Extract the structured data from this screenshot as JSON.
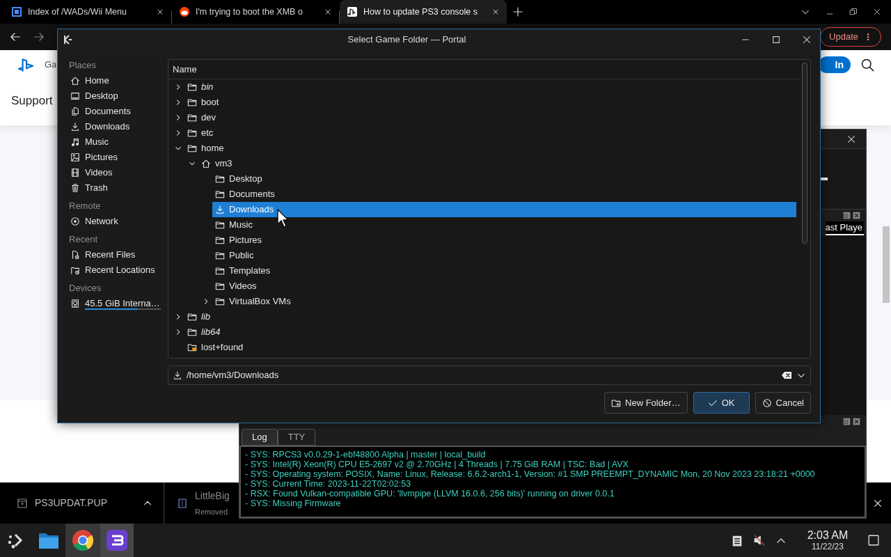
{
  "browser": {
    "tabs": [
      {
        "title": "Index of /WADs/Wii Menu",
        "selected": false
      },
      {
        "title": "I'm trying to boot the XMB o",
        "selected": false
      },
      {
        "title": "How to update PS3 console s",
        "selected": true
      }
    ],
    "update_button": "Update"
  },
  "web_page": {
    "nav_label": "Ga",
    "section_title": "Support",
    "sign_in_button": "In"
  },
  "emulator": {
    "game_list_header": "ast Playe",
    "log_tabs": [
      {
        "label": "Log",
        "selected": true
      },
      {
        "label": "TTY",
        "selected": false
      }
    ],
    "log_lines": [
      "- SYS: RPCS3 v0.0.29-1-ebf48800 Alpha | master | local_build",
      "- SYS: Intel(R) Xeon(R) CPU E5-2697 v2 @ 2.70GHz | 4 Threads | 7.75 GiB RAM | TSC: Bad | AVX",
      "- SYS: Operating system: POSIX, Name: Linux, Release: 6.6.2-arch1-1, Version: #1 SMP PREEMPT_DYNAMIC Mon, 20 Nov 2023 23:18:21 +0000",
      "- SYS: Current Time: 2023-11-22T02:02:53",
      "- RSX: Found Vulkan-compatible GPU: 'llvmpipe (LLVM 16.0.6, 256 bits)' running on driver 0.0.1",
      "- SYS: Missing Firmware"
    ]
  },
  "downloads": [
    {
      "file_name": "PS3UPDAT.PUP"
    },
    {
      "file_name": "LittleBig",
      "status": "Removed"
    }
  ],
  "dialog": {
    "title": "Select Game Folder — Portal",
    "places": [
      {
        "heading": "Places",
        "items": [
          {
            "label": "Home",
            "kind": "home"
          },
          {
            "label": "Desktop",
            "kind": "desktop"
          },
          {
            "label": "Documents",
            "kind": "documents"
          },
          {
            "label": "Downloads",
            "kind": "downloads"
          },
          {
            "label": "Music",
            "kind": "music"
          },
          {
            "label": "Pictures",
            "kind": "pictures"
          },
          {
            "label": "Videos",
            "kind": "videos"
          },
          {
            "label": "Trash",
            "kind": "trash"
          }
        ]
      },
      {
        "heading": "Remote",
        "items": [
          {
            "label": "Network",
            "kind": "network"
          }
        ]
      },
      {
        "heading": "Recent",
        "items": [
          {
            "label": "Recent Files",
            "kind": "recent-files"
          },
          {
            "label": "Recent Locations",
            "kind": "recent-locations"
          }
        ]
      },
      {
        "heading": "Devices",
        "items": [
          {
            "label": "45.5 GiB Interna…",
            "kind": "drive",
            "level": 0.7
          }
        ]
      }
    ],
    "column_header": "Name",
    "tree": [
      {
        "name": "bin",
        "kind": "folder",
        "link": true,
        "expanded": false,
        "selected": false
      },
      {
        "name": "boot",
        "kind": "folder",
        "link": false,
        "expanded": false,
        "selected": false
      },
      {
        "name": "dev",
        "kind": "folder",
        "link": false,
        "expanded": false,
        "selected": false
      },
      {
        "name": "etc",
        "kind": "folder",
        "link": false,
        "expanded": false,
        "selected": false
      },
      {
        "name": "home",
        "kind": "folder",
        "link": false,
        "expanded": true,
        "selected": false,
        "children": [
          {
            "name": "vm3",
            "kind": "home",
            "link": false,
            "expanded": true,
            "selected": false,
            "children": [
              {
                "name": "Desktop",
                "kind": "folder",
                "link": false,
                "selected": false
              },
              {
                "name": "Documents",
                "kind": "folder",
                "link": false,
                "selected": false
              },
              {
                "name": "Downloads",
                "kind": "download",
                "link": false,
                "selected": true
              },
              {
                "name": "Music",
                "kind": "folder",
                "link": false,
                "selected": false
              },
              {
                "name": "Pictures",
                "kind": "folder",
                "link": false,
                "selected": false
              },
              {
                "name": "Public",
                "kind": "folder",
                "link": false,
                "selected": false
              },
              {
                "name": "Templates",
                "kind": "folder",
                "link": false,
                "selected": false
              },
              {
                "name": "Videos",
                "kind": "folder",
                "link": false,
                "selected": false
              },
              {
                "name": "VirtualBox VMs",
                "kind": "folder",
                "link": false,
                "expanded": false,
                "selected": false
              }
            ]
          }
        ]
      },
      {
        "name": "lib",
        "kind": "folder",
        "link": true,
        "expanded": false,
        "selected": false
      },
      {
        "name": "lib64",
        "kind": "folder",
        "link": true,
        "expanded": false,
        "selected": false
      },
      {
        "name": "lost+found",
        "kind": "locked",
        "link": false,
        "selected": false
      }
    ],
    "path": "/home/vm3/Downloads",
    "buttons": [
      {
        "label": "New Folder…",
        "kind": "new-folder"
      },
      {
        "label": "OK",
        "kind": "ok"
      },
      {
        "label": "Cancel",
        "kind": "cancel"
      }
    ]
  },
  "taskbar": {
    "time": "2:03 AM",
    "date": "11/22/23"
  }
}
